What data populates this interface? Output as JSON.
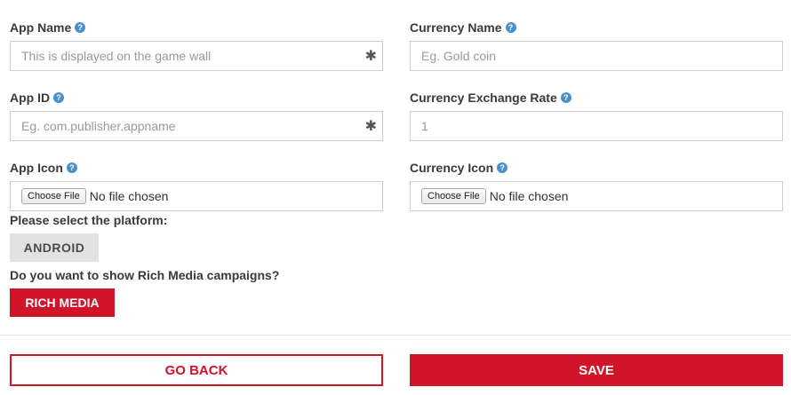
{
  "colors": {
    "brand_red": "#d0142a",
    "help_blue": "#4a90c8",
    "border_gray": "#cfcfcf",
    "platform_gray": "#e2e2e2"
  },
  "form": {
    "app_name": {
      "label": "App Name",
      "placeholder": "This is displayed on the game wall",
      "value": "",
      "required_mark": "✱"
    },
    "currency_name": {
      "label": "Currency Name",
      "placeholder": "Eg. Gold coin",
      "value": ""
    },
    "app_id": {
      "label": "App ID",
      "placeholder": "Eg. com.publisher.appname",
      "value": "",
      "required_mark": "✱"
    },
    "currency_exchange_rate": {
      "label": "Currency Exchange Rate",
      "placeholder": "1",
      "value": ""
    },
    "app_icon": {
      "label": "App Icon",
      "button_label": "Choose File",
      "status": "No file chosen"
    },
    "currency_icon": {
      "label": "Currency Icon",
      "button_label": "Choose File",
      "status": "No file chosen"
    },
    "help_glyph": "?",
    "platform": {
      "question": "Please select the platform:",
      "option_label": "ANDROID"
    },
    "rich_media": {
      "question": "Do you want to show Rich Media campaigns?",
      "button_label": "RICH MEDIA"
    }
  },
  "footer": {
    "go_back_label": "GO BACK",
    "save_label": "SAVE"
  }
}
